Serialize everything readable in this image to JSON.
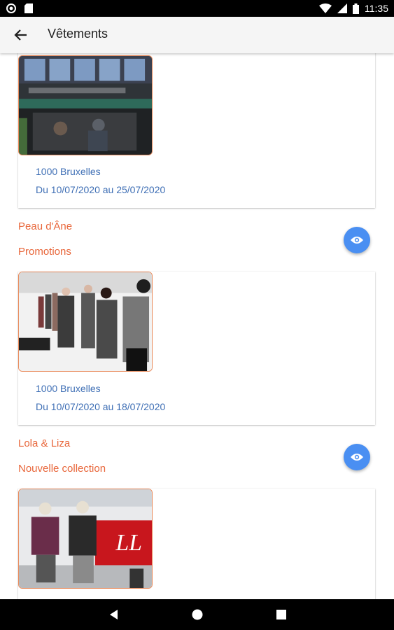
{
  "status_bar": {
    "time": "11:35"
  },
  "app_bar": {
    "title": "Vêtements",
    "back_icon": "arrow-left-icon"
  },
  "offers": [
    {
      "city": "1000 Bruxelles",
      "dates": "Du 10/07/2020 au 25/07/2020"
    },
    {
      "shop": "Peau d'Âne",
      "title": "Promotions",
      "city": "1000 Bruxelles",
      "dates": "Du 10/07/2020 au 18/07/2020"
    },
    {
      "shop": "Lola & Liza",
      "title": "Nouvelle collection"
    }
  ],
  "colors": {
    "accent_orange": "#e8663a",
    "link_blue": "#3f6fb5",
    "fab_blue": "#4a8ff2"
  }
}
